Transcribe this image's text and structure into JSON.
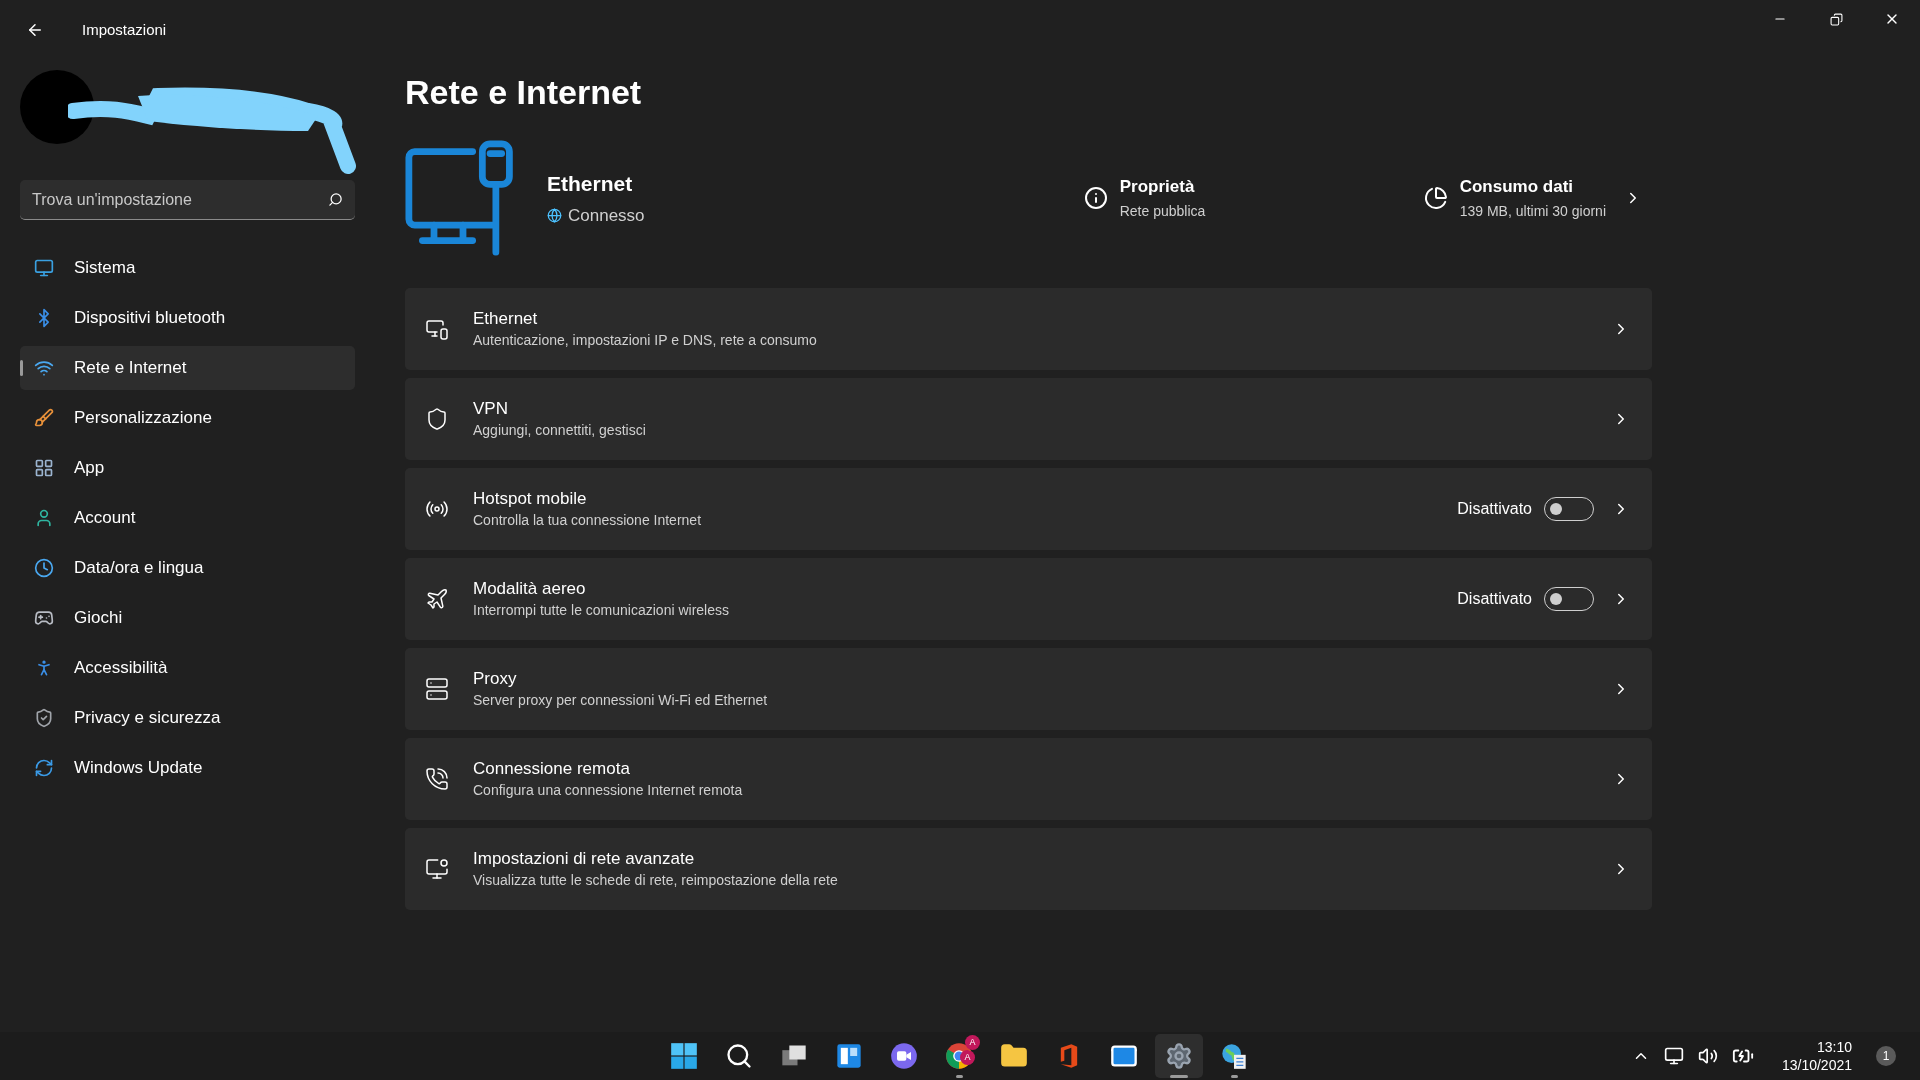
{
  "window": {
    "title": "Impostazioni"
  },
  "search": {
    "placeholder": "Trova un'impostazione"
  },
  "sidebar": {
    "items": [
      {
        "label": "Sistema",
        "selected": false
      },
      {
        "label": "Dispositivi bluetooth",
        "selected": false
      },
      {
        "label": "Rete e Internet",
        "selected": true
      },
      {
        "label": "Personalizzazione",
        "selected": false
      },
      {
        "label": "App",
        "selected": false
      },
      {
        "label": "Account",
        "selected": false
      },
      {
        "label": "Data/ora e lingua",
        "selected": false
      },
      {
        "label": "Giochi",
        "selected": false
      },
      {
        "label": "Accessibilità",
        "selected": false
      },
      {
        "label": "Privacy e sicurezza",
        "selected": false
      },
      {
        "label": "Windows Update",
        "selected": false
      }
    ]
  },
  "page": {
    "title": "Rete e Internet"
  },
  "hero": {
    "title": "Ethernet",
    "status": "Connesso",
    "properties": {
      "title": "Proprietà",
      "subtitle": "Rete pubblica"
    },
    "data_usage": {
      "title": "Consumo dati",
      "subtitle": "139 MB, ultimi 30 giorni"
    }
  },
  "rows": [
    {
      "title": "Ethernet",
      "subtitle": "Autenticazione, impostazioni IP e DNS, rete a consumo"
    },
    {
      "title": "VPN",
      "subtitle": "Aggiungi, connettiti, gestisci"
    },
    {
      "title": "Hotspot mobile",
      "subtitle": "Controlla la tua connessione Internet",
      "toggle": {
        "label": "Disattivato",
        "on": false
      }
    },
    {
      "title": "Modalità aereo",
      "subtitle": "Interrompi tutte le comunicazioni wireless",
      "toggle": {
        "label": "Disattivato",
        "on": false
      }
    },
    {
      "title": "Proxy",
      "subtitle": "Server proxy per connessioni Wi-Fi ed Ethernet"
    },
    {
      "title": "Connessione remota",
      "subtitle": "Configura una connessione Internet remota"
    },
    {
      "title": "Impostazioni di rete avanzate",
      "subtitle": "Visualizza tutte le schede di rete, reimpostazione della rete"
    }
  ],
  "taskbar": {
    "apps": [
      {
        "selected": false,
        "running": false
      },
      {
        "selected": false,
        "running": false
      },
      {
        "selected": false,
        "running": false
      },
      {
        "selected": false,
        "running": false
      },
      {
        "selected": false,
        "running": false
      },
      {
        "selected": false,
        "running": true,
        "badges": [
          "A",
          "A"
        ]
      },
      {
        "selected": false,
        "running": false
      },
      {
        "selected": false,
        "running": false
      },
      {
        "selected": false,
        "running": false
      },
      {
        "selected": true,
        "running": true
      },
      {
        "selected": false,
        "running": true
      }
    ],
    "time": "13:10",
    "date": "13/10/2021",
    "notifications": "1"
  }
}
